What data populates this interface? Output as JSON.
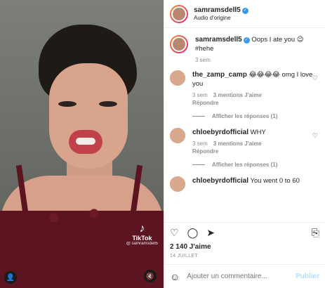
{
  "post": {
    "username": "samramsdell5",
    "audio": "Audio d'origine",
    "caption_text": "Oops I ate you 😉 #hehe",
    "caption_time": "3 sem"
  },
  "media": {
    "watermark_logo": "♪",
    "watermark_name": "TikTok",
    "watermark_handle": "@ samramsdell5"
  },
  "comments": [
    {
      "username": "the_zamp_camp",
      "text": "😂😂😂😂 omg I love you",
      "time": "3 sem",
      "likes": "3 mentions J'aime",
      "reply": "Répondre",
      "replies": "Afficher les réponses (1)"
    },
    {
      "username": "chloebyrdofficial",
      "text": "WHY",
      "time": "3 sem",
      "likes": "3 mentions J'aime",
      "reply": "Répondre",
      "replies": "Afficher les réponses (1)"
    },
    {
      "username": "chloebyrdofficial",
      "text": "You went 0 to 60"
    }
  ],
  "actions": {
    "likes": "2 140 J'aime",
    "date": "14 JUILLET",
    "comment_placeholder": "Ajouter un commentaire...",
    "publish": "Publier"
  },
  "colors": {
    "link": "#3897f0",
    "publish_disabled": "#b2dffc",
    "lingerie": "#5b1420"
  }
}
